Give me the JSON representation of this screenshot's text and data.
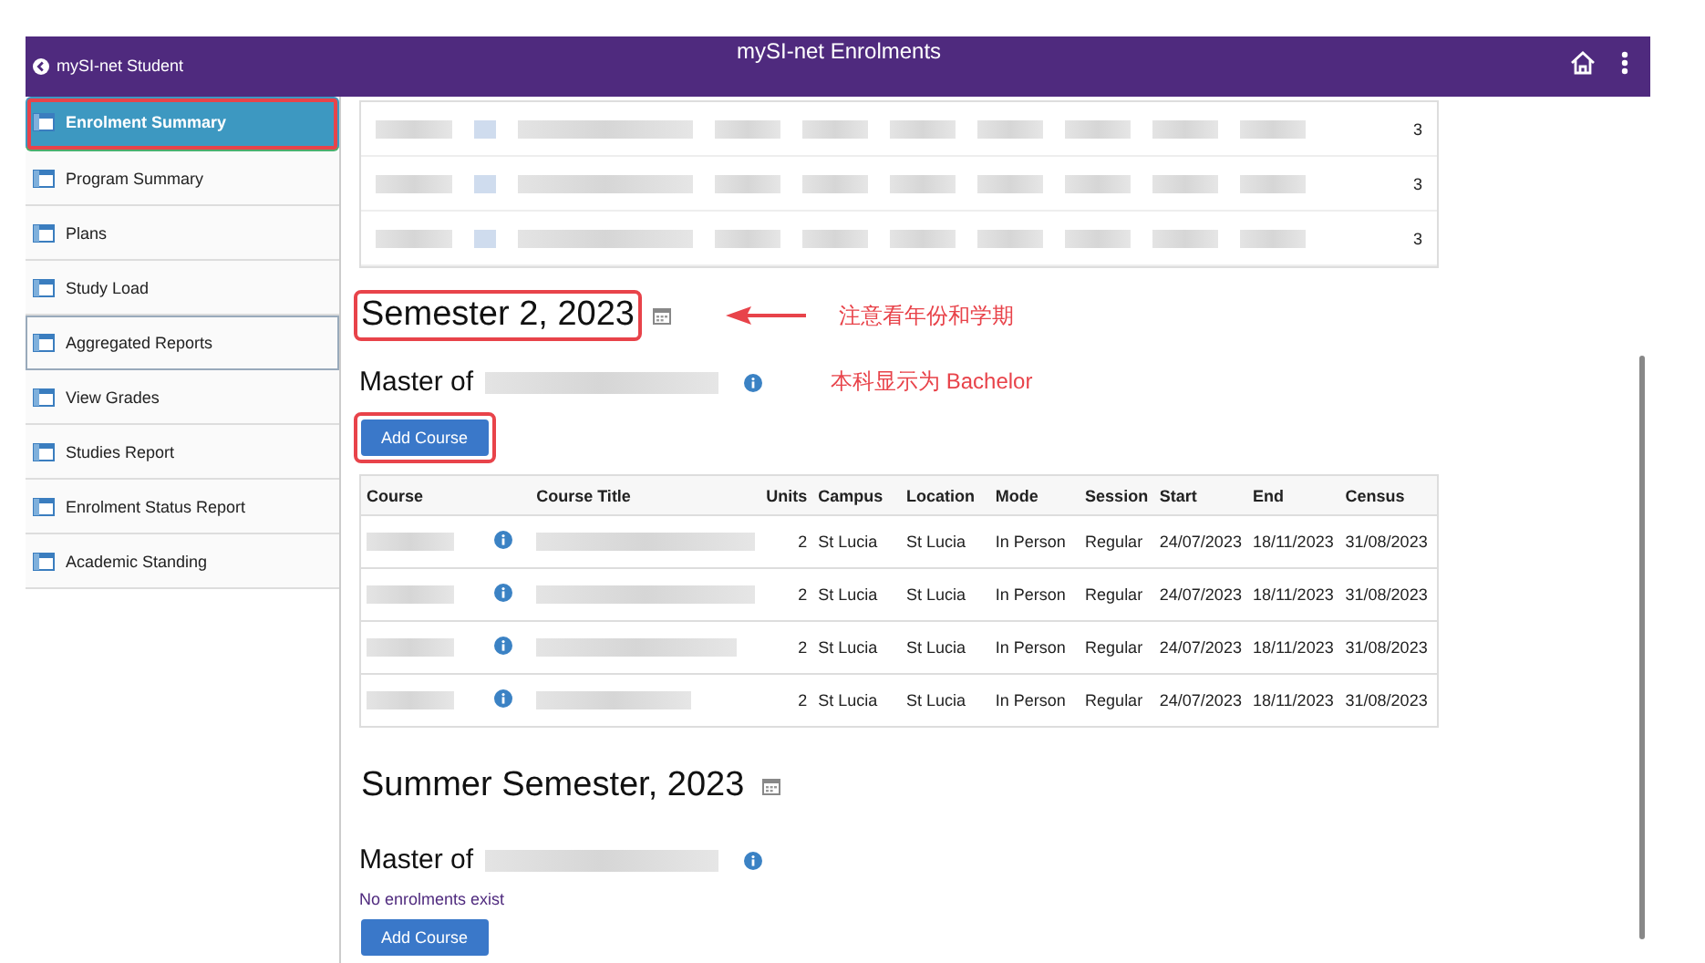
{
  "header": {
    "back_label": "mySI-net Student",
    "title": "mySI-net Enrolments"
  },
  "sidebar": {
    "items": [
      {
        "label": "Enrolment Summary",
        "selected": true,
        "highlighted": true,
        "focused": false
      },
      {
        "label": "Program Summary",
        "selected": false,
        "highlighted": false,
        "focused": false
      },
      {
        "label": "Plans",
        "selected": false,
        "highlighted": false,
        "focused": false
      },
      {
        "label": "Study Load",
        "selected": false,
        "highlighted": false,
        "focused": false
      },
      {
        "label": "Aggregated Reports",
        "selected": false,
        "highlighted": false,
        "focused": true
      },
      {
        "label": "View Grades",
        "selected": false,
        "highlighted": false,
        "focused": false
      },
      {
        "label": "Studies Report",
        "selected": false,
        "highlighted": false,
        "focused": false
      },
      {
        "label": "Enrolment Status Report",
        "selected": false,
        "highlighted": false,
        "focused": false
      },
      {
        "label": "Academic Standing",
        "selected": false,
        "highlighted": false,
        "focused": false
      }
    ]
  },
  "previous_table": {
    "rows": [
      {
        "last_cell": "3"
      },
      {
        "last_cell": "3"
      },
      {
        "last_cell": "3"
      }
    ]
  },
  "terms": [
    {
      "title": "Semester 2, 2023",
      "highlighted": true,
      "annotation": "注意看年份和学期",
      "program": "Master of",
      "program_annotation": "本科显示为 Bachelor",
      "add_button": {
        "label": "Add Course",
        "highlighted": true
      },
      "table": {
        "columns": [
          "Course",
          "",
          "Course Title",
          "Units",
          "Campus",
          "Location",
          "Mode",
          "Session",
          "Start",
          "End",
          "Census"
        ],
        "rows": [
          {
            "units": "2",
            "campus": "St Lucia",
            "location": "St Lucia",
            "mode": "In Person",
            "session": "Regular",
            "start": "24/07/2023",
            "end": "18/11/2023",
            "census": "31/08/2023"
          },
          {
            "units": "2",
            "campus": "St Lucia",
            "location": "St Lucia",
            "mode": "In Person",
            "session": "Regular",
            "start": "24/07/2023",
            "end": "18/11/2023",
            "census": "31/08/2023"
          },
          {
            "units": "2",
            "campus": "St Lucia",
            "location": "St Lucia",
            "mode": "In Person",
            "session": "Regular",
            "start": "24/07/2023",
            "end": "18/11/2023",
            "census": "31/08/2023"
          },
          {
            "units": "2",
            "campus": "St Lucia",
            "location": "St Lucia",
            "mode": "In Person",
            "session": "Regular",
            "start": "24/07/2023",
            "end": "18/11/2023",
            "census": "31/08/2023"
          }
        ]
      }
    },
    {
      "title": "Summer Semester, 2023",
      "highlighted": false,
      "program": "Master of",
      "message": "No enrolments exist",
      "add_button": {
        "label": "Add Course",
        "highlighted": false
      }
    }
  ]
}
